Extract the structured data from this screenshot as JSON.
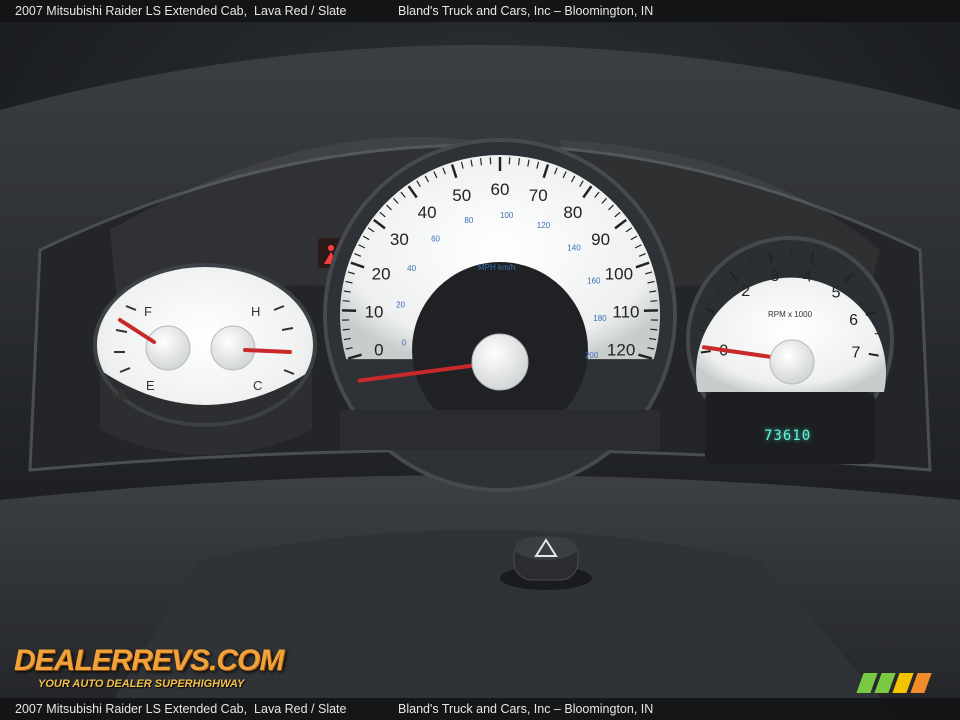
{
  "caption": {
    "vehicle": "2007 Mitsubishi Raider LS Extended Cab,",
    "colors": "Lava Red / Slate",
    "dealer": "Bland's Truck and Cars, Inc – Bloomington, IN"
  },
  "speedometer": {
    "mph_labels": [
      "0",
      "10",
      "20",
      "30",
      "40",
      "50",
      "60",
      "70",
      "80",
      "90",
      "100",
      "110",
      "120"
    ],
    "kmh_labels": [
      "0",
      "20",
      "40",
      "60",
      "80",
      "100",
      "120",
      "140",
      "160",
      "180",
      "200"
    ],
    "unit_label": "MPH km/h",
    "needle_mph": 1
  },
  "tachometer": {
    "labels": [
      "0",
      "2",
      "3",
      "4",
      "5",
      "6",
      "7"
    ],
    "unit_label": "RPM x 1000",
    "needle_rpm": 0.3
  },
  "fuel_gauge": {
    "full_label": "F",
    "empty_label": "E"
  },
  "temp_gauge": {
    "hot_label": "H",
    "cold_label": "C"
  },
  "odometer": "73610",
  "watermark": {
    "brand": "DEALERREVS.COM",
    "tagline": "YOUR AUTO DEALER SUPERHIGHWAY",
    "colors": {
      "brand": "#f2a23a",
      "stripes": [
        "#7ac943",
        "#f5c400",
        "#f28c28"
      ]
    }
  },
  "icons": [
    "airbag-warning-icon",
    "fuel-pump-icon",
    "coolant-temp-icon",
    "hazard-triangle-icon"
  ]
}
